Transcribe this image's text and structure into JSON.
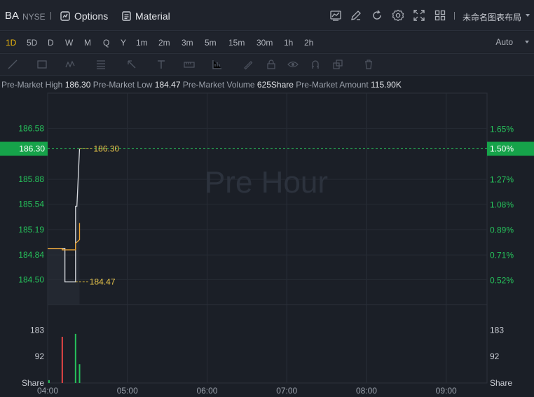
{
  "header": {
    "symbol": "BA",
    "exchange": "NYSE",
    "options_label": "Options",
    "material_label": "Material",
    "layout_label": "未命名图表布局",
    "icons": [
      "chart-icon",
      "edit-icon",
      "refresh-icon",
      "settings-icon",
      "fullscreen-icon",
      "grid-layout-icon"
    ]
  },
  "periods": [
    "1D",
    "5D",
    "D",
    "W",
    "M",
    "Q",
    "Y",
    "1m",
    "2m",
    "3m",
    "5m",
    "15m",
    "30m",
    "1h",
    "2h"
  ],
  "active_period": "1D",
  "auto_label": "Auto",
  "info": {
    "high_label": "Pre-Market High",
    "high_value": "186.30",
    "low_label": "Pre-Market Low",
    "low_value": "184.47",
    "volume_label": "Pre-Market Volume",
    "volume_value": "625Share",
    "amount_label": "Pre-Market Amount",
    "amount_value": "115.90K"
  },
  "watermark": "Pre Hour",
  "colors": {
    "accent": "#f0b90b",
    "up": "#26c25b",
    "down": "#e64545",
    "price_line": "#f0a530",
    "line": "#d8dbe0"
  },
  "chart_data": {
    "type": "line",
    "price_axis_left": [
      "186.58",
      "185.88",
      "185.54",
      "185.19",
      "184.84",
      "184.50"
    ],
    "current_price": "186.30",
    "pct_axis_right": [
      "1.65%",
      "1.50%",
      "1.27%",
      "1.08%",
      "0.89%",
      "0.71%",
      "0.52%"
    ],
    "current_pct": "1.50%",
    "high_label": "186.30",
    "low_label": "184.47",
    "time_labels": [
      "04:00",
      "05:00",
      "06:00",
      "07:00",
      "08:00",
      "09:00"
    ],
    "volume_axis": [
      "183",
      "92"
    ],
    "volume_unit": "Share",
    "price_series": {
      "x": [
        "04:00",
        "04:13",
        "04:13",
        "04:21",
        "04:21",
        "04:22",
        "04:24",
        "04:24"
      ],
      "y": [
        184.93,
        184.93,
        184.47,
        184.47,
        185.51,
        185.51,
        186.3,
        186.3
      ]
    },
    "avg_series": {
      "x": [
        "04:00",
        "04:11",
        "04:11",
        "04:21",
        "04:21",
        "04:24",
        "04:24"
      ],
      "y": [
        184.93,
        184.93,
        184.91,
        184.91,
        185.0,
        185.05,
        185.28
      ]
    },
    "volume_bars": [
      {
        "time": "04:01",
        "value": 10,
        "color": "up"
      },
      {
        "time": "04:11",
        "value": 160,
        "color": "down"
      },
      {
        "time": "04:21",
        "value": 170,
        "color": "up"
      },
      {
        "time": "04:24",
        "value": 65,
        "color": "up"
      }
    ]
  }
}
